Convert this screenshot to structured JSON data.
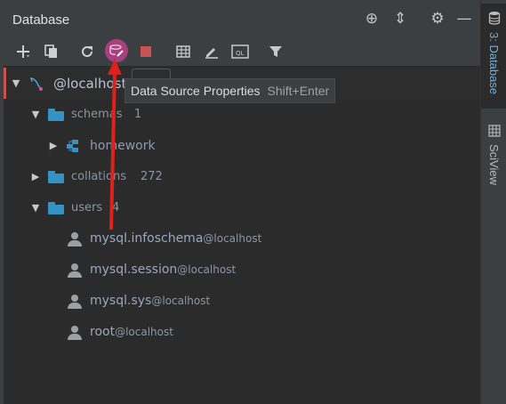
{
  "panel": {
    "title": "Database"
  },
  "title_icons": [
    {
      "name": "crosshair-icon",
      "glyph": "⊕"
    },
    {
      "name": "collapse-icon",
      "glyph": "⇕"
    },
    {
      "name": "gear-icon",
      "glyph": "⚙"
    },
    {
      "name": "minimize-icon",
      "glyph": "—"
    }
  ],
  "toolbar": {
    "items": [
      "add-icon",
      "copy-icon",
      "refresh-icon",
      "data-source-properties-icon",
      "stop-icon",
      "table-icon",
      "edit-icon",
      "query-console-icon",
      "filter-icon"
    ]
  },
  "tree": {
    "root": {
      "label": "@localhost"
    },
    "schemas": {
      "label": "schemas",
      "count": "1"
    },
    "homework": {
      "label": "homework"
    },
    "collations": {
      "label": "collations",
      "count": "272"
    },
    "users": {
      "label": "users",
      "count": "4"
    },
    "user_items": [
      {
        "name": "mysql.infoschema",
        "host": "@localhost"
      },
      {
        "name": "mysql.session",
        "host": "@localhost"
      },
      {
        "name": "mysql.sys",
        "host": "@localhost"
      },
      {
        "name": "root",
        "host": "@localhost"
      }
    ]
  },
  "tooltip": {
    "text": "Data Source Properties",
    "shortcut": "Shift+Enter"
  },
  "side_tabs": [
    {
      "label": "3: Database",
      "icon": "database-icon"
    },
    {
      "label": "SciView",
      "icon": "grid-icon"
    }
  ],
  "colors": {
    "accent": "#6fb0e0",
    "active_button": "#a6407f",
    "folder": "#3592c4",
    "annotation_arrow": "#e0201a"
  }
}
